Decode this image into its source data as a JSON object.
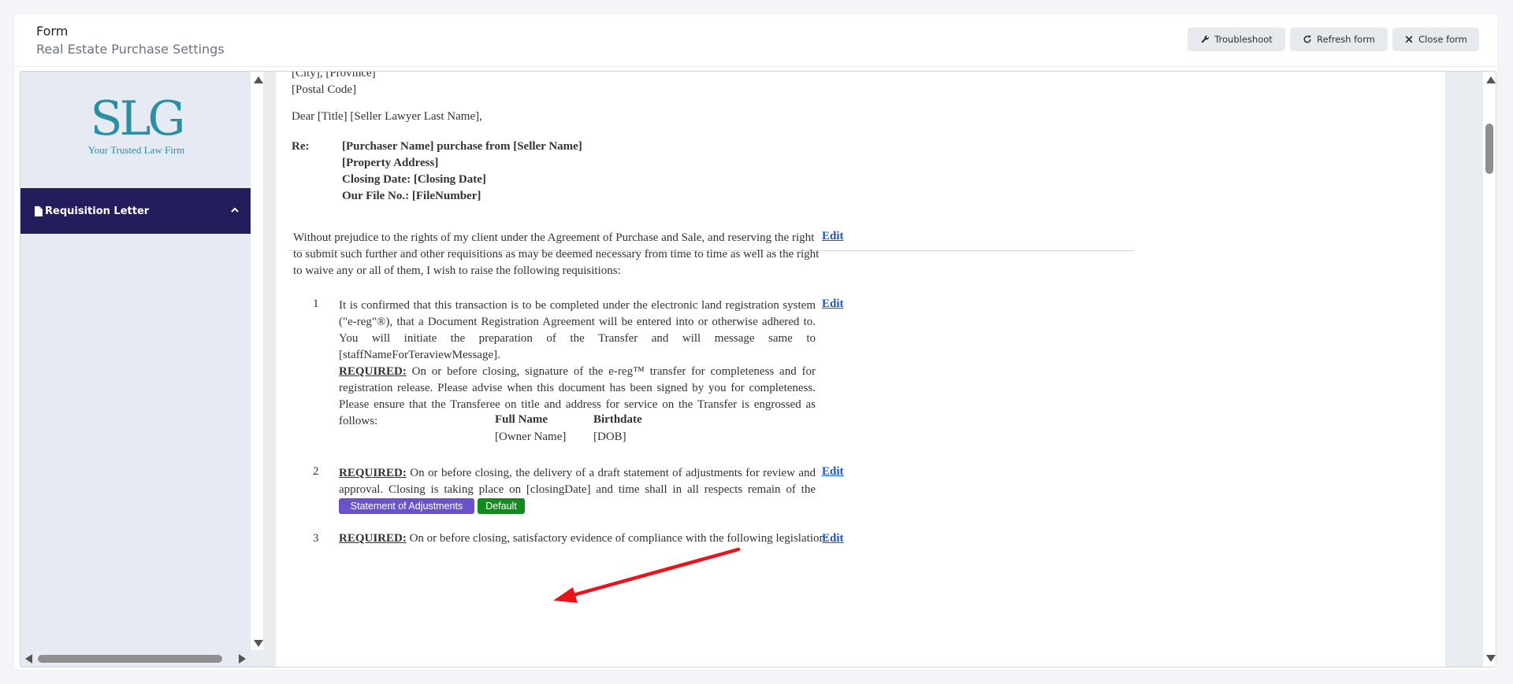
{
  "header": {
    "title": "Form",
    "subtitle": "Real Estate Purchase Settings",
    "buttons": {
      "troubleshoot": "Troubleshoot",
      "refresh": "Refresh form",
      "close": "Close form"
    }
  },
  "sidebar": {
    "logo": {
      "main": "SLG",
      "tagline": "Your Trusted Law Firm"
    },
    "items": [
      {
        "label": "Requisition Letter",
        "icon": "document-icon",
        "expanded": true
      }
    ]
  },
  "document": {
    "address_lines": [
      "[City], [Province]",
      "[Postal Code]"
    ],
    "salutation": "Dear [Title] [Seller Lawyer Last Name],",
    "re_label": "Re:",
    "re_lines": [
      "[Purchaser Name] purchase from [Seller Name]",
      "[Property Address]",
      "Closing Date: [Closing Date]",
      "Our File No.: [FileNumber]"
    ],
    "intro": "Without prejudice to the rights of my client under the Agreement of Purchase and Sale, and reserving the right to submit such further and other requisitions as may be deemed necessary from time to time as well as the right to waive any or all of them, I wish to raise the following requisitions:",
    "edit_label": "Edit",
    "required_label": "REQUIRED:",
    "items": [
      {
        "number": "1",
        "text": "It is confirmed that this transaction is to be completed under the electronic land registration system (\"e-reg\"®), that a Document Registration Agreement will be entered into or otherwise adhered to. You will initiate the preparation of the Transfer and will message same to [staffNameForTeraviewMessage].",
        "required_text": "On or before closing, signature of the e-reg™ transfer for completeness and for registration release. Please advise when this document has been signed by you for completeness. Please ensure that the Transferee on title and address for service on the Transfer is engrossed as follows:",
        "table": {
          "headers": [
            "Full Name",
            "Birthdate"
          ],
          "row": [
            "[Owner Name]",
            "[DOB]"
          ]
        }
      },
      {
        "number": "2",
        "required_text": "On or before closing, the delivery of a draft statement of adjustments for review and approval. Closing is taking place on [closingDate] and time shall in all respects remain of the essence.",
        "tags": [
          "Statement of Adjustments",
          "Default"
        ]
      },
      {
        "number": "3",
        "required_text": "On or before closing, satisfactory evidence of compliance with the following legislation:"
      }
    ]
  },
  "colors": {
    "nav_bg": "#241d5c",
    "logo": "#2b8fa3",
    "link": "#1a56c6",
    "tag_purple": "#6a52c8",
    "tag_green": "#138a1e",
    "annotation_arrow": "#e8141c"
  }
}
